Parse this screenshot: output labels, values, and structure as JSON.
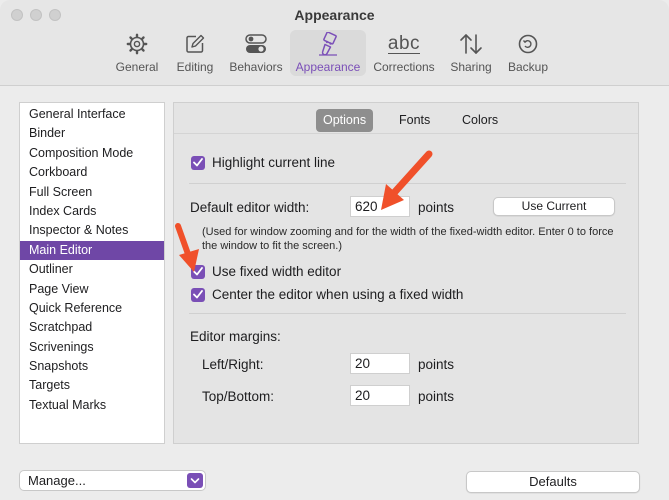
{
  "window": {
    "title": "Appearance"
  },
  "toolbar": {
    "items": [
      {
        "label": "General",
        "icon": "gear-icon"
      },
      {
        "label": "Editing",
        "icon": "pencil-square-icon"
      },
      {
        "label": "Behaviors",
        "icon": "toggles-icon"
      },
      {
        "label": "Appearance",
        "icon": "paintbrush-icon",
        "active": true
      },
      {
        "label": "Corrections",
        "icon": "abc-icon",
        "glyph": "abc"
      },
      {
        "label": "Sharing",
        "icon": "arrows-updown-icon"
      },
      {
        "label": "Backup",
        "icon": "backup-clock-icon"
      }
    ]
  },
  "sidebar": {
    "items": [
      {
        "label": "General Interface"
      },
      {
        "label": "Binder"
      },
      {
        "label": "Composition Mode"
      },
      {
        "label": "Corkboard"
      },
      {
        "label": "Full Screen"
      },
      {
        "label": "Index Cards"
      },
      {
        "label": "Inspector & Notes"
      },
      {
        "label": "Main Editor",
        "selected": true
      },
      {
        "label": "Outliner"
      },
      {
        "label": "Page View"
      },
      {
        "label": "Quick Reference"
      },
      {
        "label": "Scratchpad"
      },
      {
        "label": "Scrivenings"
      },
      {
        "label": "Snapshots"
      },
      {
        "label": "Targets"
      },
      {
        "label": "Textual Marks"
      }
    ]
  },
  "tabs": {
    "options": "Options",
    "fonts": "Fonts",
    "colors": "Colors",
    "selected": "Options"
  },
  "options": {
    "highlight_line": {
      "label": "Highlight current line",
      "checked": true
    },
    "editor_width": {
      "label": "Default editor width:",
      "value": "620",
      "unit": "points",
      "button": "Use Current"
    },
    "width_note": "(Used for window zooming and for the width of the fixed-width editor. Enter 0 to force the window to fit the screen.)",
    "fixed_width": {
      "label": "Use fixed width editor",
      "checked": true
    },
    "center_editor": {
      "label": "Center the editor when using a fixed width",
      "checked": true
    },
    "margins": {
      "heading": "Editor margins:",
      "left_right": {
        "label": "Left/Right:",
        "value": "20",
        "unit": "points"
      },
      "top_bottom": {
        "label": "Top/Bottom:",
        "value": "20",
        "unit": "points"
      }
    }
  },
  "footer": {
    "manage": "Manage...",
    "defaults": "Defaults"
  },
  "colors": {
    "accent": "#7a4fb6",
    "annotation_arrow": "#f0502a"
  }
}
